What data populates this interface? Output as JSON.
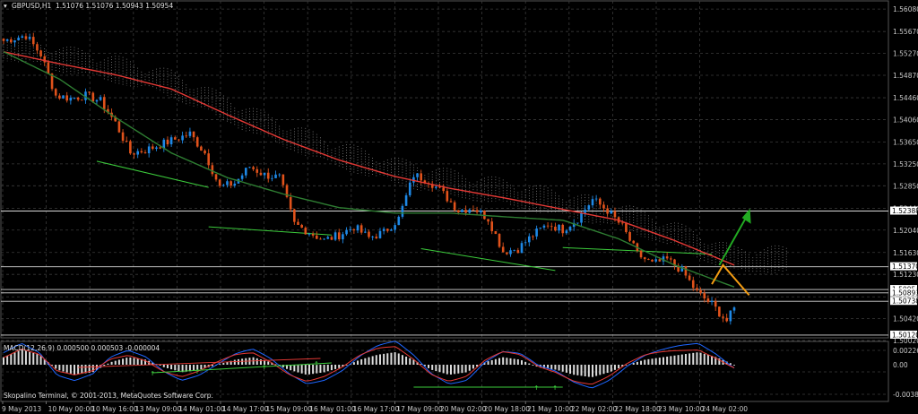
{
  "header": {
    "symbol_label": "GBPUSD,H1",
    "ohlc": "1.51076 1.51076 1.50943 1.50954"
  },
  "macd": {
    "label": "MACD(12,26,9) 0.000500 0.000503 -0.000004",
    "axis_ticks": [
      "0.00226",
      "0.00",
      "-0.00387"
    ]
  },
  "footer": {
    "copyright": "Skopalino Terminal, © 2001-2013, MetaQuotes Software Corp."
  },
  "colors": {
    "background": "#000000",
    "grid": "#3a3a3a",
    "bull": "#1e88e5",
    "bear": "#e0521b",
    "ma_slow": "#e53935",
    "ma_fast": "#2e7d32",
    "cloud": "#d0d0d0",
    "trend": "#3ccc3c",
    "forecast_orange": "#f39c12",
    "macd_line": "#1e66ff",
    "signal_line": "#e53935",
    "arrow_green": "#22aa22"
  },
  "chart_data": {
    "type": "line",
    "title": "GBPUSD,H1",
    "ylim": [
      1.5007,
      1.5623
    ],
    "grid": true,
    "price_ticks": [
      "1.56080",
      "1.55670",
      "1.55270",
      "1.54870",
      "1.54460",
      "1.54060",
      "1.53650",
      "1.53250",
      "1.52850",
      "1.52440",
      "1.52040",
      "1.51630",
      "1.51230",
      "1.50820",
      "1.50420",
      "1.50020"
    ],
    "price_levels": [
      {
        "value": 1.52388,
        "label": "1.52388"
      },
      {
        "value": 1.5137,
        "label": "1.51370"
      },
      {
        "value": 1.50954,
        "label": "1.50954"
      },
      {
        "value": 1.50893,
        "label": "1.50893"
      },
      {
        "value": 1.50738,
        "label": "1.50738"
      },
      {
        "value": 1.5012,
        "label": "1.50120"
      }
    ],
    "x_labels": [
      "9 May 2013",
      "10 May 00:00",
      "10 May 16:00",
      "13 May 09:00",
      "14 May 01:00",
      "14 May 17:00",
      "15 May 09:00",
      "16 May 01:00",
      "16 May 17:00",
      "17 May 09:00",
      "20 May 02:00",
      "20 May 18:00",
      "21 May 10:00",
      "22 May 02:00",
      "22 May 18:00",
      "23 May 10:00",
      "24 May 02:00"
    ],
    "series": [
      {
        "x": [
          0,
          6,
          10,
          14,
          18,
          22,
          26,
          30,
          34,
          38,
          42,
          46,
          50,
          54,
          58,
          62,
          66,
          70,
          74,
          78,
          82,
          86,
          90,
          94,
          98,
          102,
          106,
          110,
          114,
          118,
          122,
          126,
          130,
          134,
          138,
          142,
          146,
          150,
          154,
          158,
          162,
          166,
          170,
          174,
          178,
          182,
          186,
          190,
          194,
          196
        ],
        "close": [
          1.555,
          1.556,
          1.5525,
          1.545,
          1.5445,
          1.545,
          1.544,
          1.54,
          1.5345,
          1.535,
          1.536,
          1.537,
          1.538,
          1.5345,
          1.5282,
          1.529,
          1.532,
          1.5305,
          1.53,
          1.5215,
          1.52,
          1.5185,
          1.5195,
          1.521,
          1.519,
          1.52,
          1.5225,
          1.5305,
          1.5295,
          1.527,
          1.524,
          1.5245,
          1.5225,
          1.5165,
          1.517,
          1.5195,
          1.5215,
          1.5205,
          1.5225,
          1.526,
          1.524,
          1.521,
          1.516,
          1.5142,
          1.515,
          1.513,
          1.509,
          1.5068,
          1.5038,
          1.506
        ]
      },
      {
        "x": [
          0,
          15,
          30,
          45,
          60,
          75,
          90,
          105,
          120,
          135,
          150,
          165,
          180,
          196
        ],
        "ma_slow": [
          1.553,
          1.5508,
          1.5488,
          1.5462,
          1.5415,
          1.537,
          1.5332,
          1.5302,
          1.528,
          1.5262,
          1.5242,
          1.5222,
          1.5185,
          1.514
        ]
      },
      {
        "x": [
          0,
          15,
          30,
          45,
          60,
          75,
          90,
          105,
          120,
          135,
          150,
          165,
          180,
          196
        ],
        "ma_fast": [
          1.553,
          1.548,
          1.541,
          1.5345,
          1.53,
          1.527,
          1.5245,
          1.5235,
          1.5235,
          1.5228,
          1.5222,
          1.5188,
          1.514,
          1.51
        ]
      }
    ],
    "macd_histogram": [
      0.0003,
      0.0006,
      0.0004,
      -0.0002,
      -0.0004,
      -0.0003,
      0.0001,
      0.0003,
      0.0002,
      -0.0001,
      -0.0003,
      -0.0002,
      0.0,
      0.0002,
      0.0003,
      0.0001,
      -0.0002,
      -0.0004,
      -0.0003,
      -0.0001,
      0.0002,
      0.0004,
      0.0005,
      0.0002,
      -0.0002,
      -0.0004,
      -0.0003,
      0.0001,
      0.0003,
      0.0002,
      -0.0001,
      -0.0002,
      -0.0004,
      -0.0005,
      -0.0003,
      0.0,
      0.0002,
      0.0003,
      0.0004,
      0.0005,
      0.0003,
      0.0
    ]
  }
}
